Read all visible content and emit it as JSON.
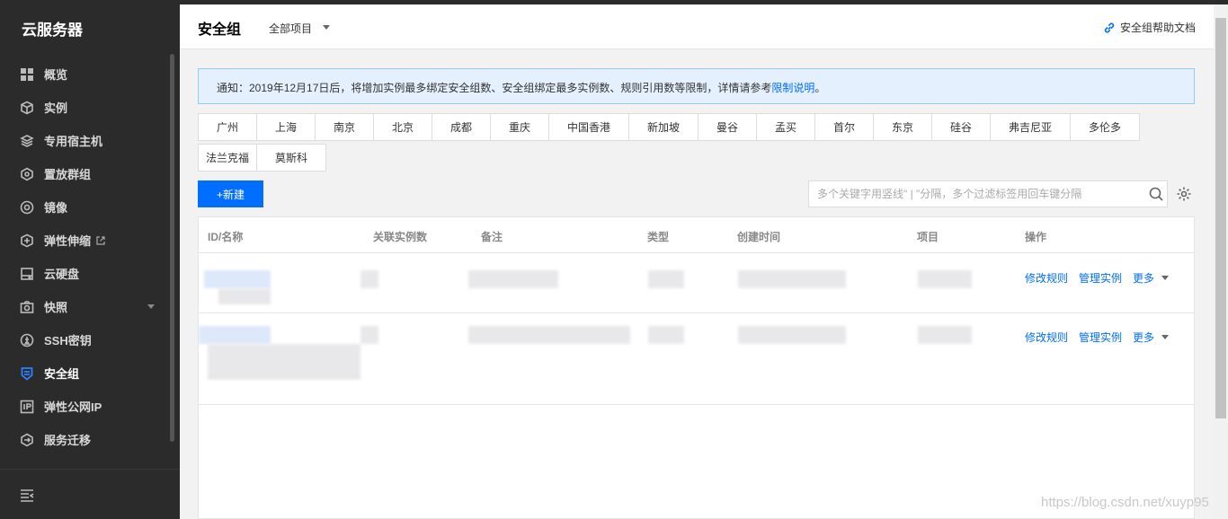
{
  "sidebar": {
    "brand": "云服务器",
    "items": [
      {
        "label": "概览",
        "icon": "grid-icon"
      },
      {
        "label": "实例",
        "icon": "cube-icon"
      },
      {
        "label": "专用宿主机",
        "icon": "layers-icon"
      },
      {
        "label": "置放群组",
        "icon": "hexagon-icon"
      },
      {
        "label": "镜像",
        "icon": "disc-icon"
      },
      {
        "label": "弹性伸缩",
        "icon": "box-scale-icon"
      },
      {
        "label": "云硬盘",
        "icon": "disk-icon"
      },
      {
        "label": "快照",
        "icon": "camera-icon"
      },
      {
        "label": "SSH密钥",
        "icon": "key-icon"
      },
      {
        "label": "安全组",
        "icon": "shield-icon"
      },
      {
        "label": "弹性公网IP",
        "icon": "ip-icon"
      },
      {
        "label": "服务迁移",
        "icon": "migrate-icon"
      }
    ],
    "active_index": 9
  },
  "header": {
    "title": "安全组",
    "project": "全部项目",
    "help": "安全组帮助文档"
  },
  "notice": {
    "text": "通知：2019年12月17日后，将增加实例最多绑定安全组数、安全组绑定最多实例数、规则引用数等限制，详情请参考",
    "link": "限制说明",
    "end": "。"
  },
  "regions": {
    "row1": [
      "广州",
      "上海",
      "南京",
      "北京",
      "成都",
      "重庆",
      "中国香港",
      "新加坡",
      "曼谷",
      "孟买",
      "首尔",
      "东京",
      "硅谷",
      "弗吉尼亚",
      "多伦多"
    ],
    "row2": [
      "法兰克福",
      "莫斯科"
    ]
  },
  "toolbar": {
    "new_label": "+新建",
    "search_placeholder": "多个关键字用竖线\" | \"分隔，多个过滤标签用回车键分隔"
  },
  "table": {
    "columns": [
      "ID/名称",
      "关联实例数",
      "备注",
      "类型",
      "创建时间",
      "项目",
      "操作"
    ],
    "row_actions": [
      "修改规则",
      "管理实例",
      "更多"
    ]
  },
  "watermark": "https://blog.csdn.net/xuyp95",
  "colors": {
    "accent": "#006eff",
    "sidebar_bg": "#2b2b2b",
    "notice_bg": "#e5f0ff"
  }
}
